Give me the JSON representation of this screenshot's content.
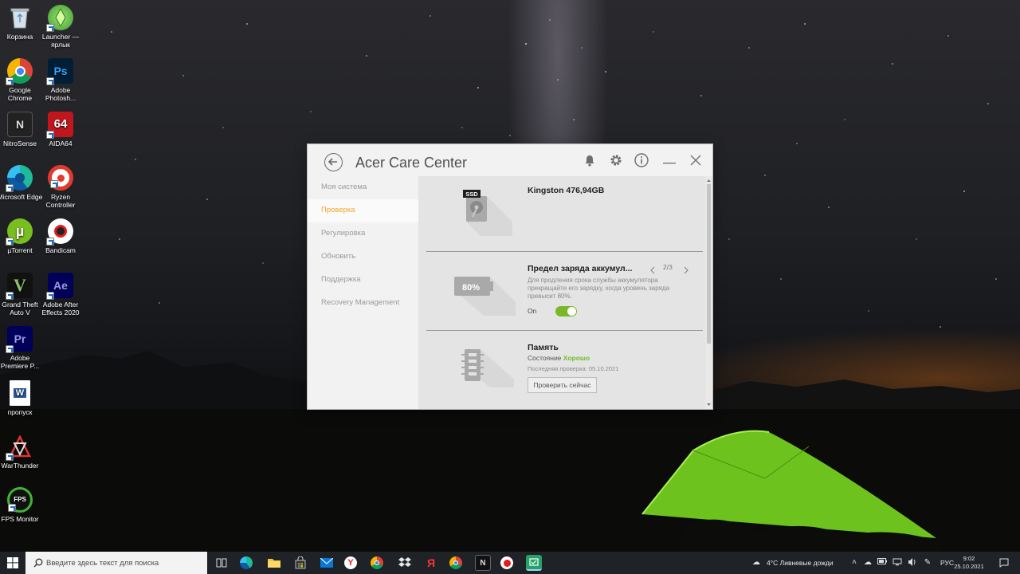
{
  "desktop": {
    "icons": [
      {
        "label": "Корзина",
        "icon": "recycle-bin-icon"
      },
      {
        "label": "Launcher — ярлык",
        "icon": "sims-launcher-icon"
      },
      {
        "label": "Google Chrome",
        "icon": "chrome-icon"
      },
      {
        "label": "Adobe Photosh...",
        "icon": "photoshop-icon",
        "glyph": "Ps"
      },
      {
        "label": "NitroSense",
        "icon": "nitrosense-icon",
        "glyph": "N"
      },
      {
        "label": "AIDA64",
        "icon": "aida64-icon",
        "glyph": "64"
      },
      {
        "label": "Microsoft Edge",
        "icon": "edge-icon"
      },
      {
        "label": "Ryzen Controller",
        "icon": "ryzen-controller-icon"
      },
      {
        "label": "µTorrent",
        "icon": "utorrent-icon",
        "glyph": "µ"
      },
      {
        "label": "Bandicam",
        "icon": "bandicam-icon"
      },
      {
        "label": "Grand Theft Auto V",
        "icon": "gta-v-icon",
        "glyph": "V"
      },
      {
        "label": "Adobe After Effects 2020",
        "icon": "after-effects-icon",
        "glyph": "Ae"
      },
      {
        "label": "Adobe Premiere P...",
        "icon": "premiere-icon",
        "glyph": "Pr"
      },
      {
        "label": "пропуск",
        "icon": "word-document-icon",
        "glyph": "W"
      },
      {
        "label": "WarThunder",
        "icon": "warthunder-icon"
      },
      {
        "label": "FPS Monitor",
        "icon": "fps-monitor-icon",
        "glyph": "FPS"
      }
    ]
  },
  "window": {
    "title": "Acer Care Center",
    "header_icons": [
      "back-arrow-icon",
      "bell-icon",
      "gear-icon",
      "info-icon",
      "minimize-icon",
      "close-icon"
    ],
    "sidebar": [
      {
        "label": "Моя система",
        "active": false
      },
      {
        "label": "Проверка",
        "active": true
      },
      {
        "label": "Регулировка",
        "active": false
      },
      {
        "label": "Обновить",
        "active": false
      },
      {
        "label": "Поддержка",
        "active": false
      },
      {
        "label": "Recovery Management",
        "active": false
      }
    ],
    "cards": {
      "ssd": {
        "badge": "SSD",
        "title": "Kingston 476,94GB"
      },
      "battery": {
        "badge": "80%",
        "title": "Предел заряда аккумул...",
        "pager": "2/3",
        "description": "Для продления срока службы аккумулятора прекращайте его зарядку, когда уровень заряда превысит 80%.",
        "toggle_label": "On",
        "toggle_on": true
      },
      "memory": {
        "title": "Память",
        "status_label": "Состояние",
        "status_value": "Хорошо",
        "last_check": "Последняя проверка: 05.10.2021",
        "button": "Проверить сейчас"
      }
    },
    "colors": {
      "accent": "#f5a623",
      "good": "#76b82a",
      "toggle": "#7ab829"
    }
  },
  "taskbar": {
    "search_placeholder": "Введите здесь текст для поиска",
    "apps": [
      "task-view-icon",
      "edge-icon",
      "file-explorer-icon",
      "store-icon",
      "mail-icon",
      "yandex-browser-icon",
      "chrome-icon",
      "dropbox-icon",
      "yandex-icon",
      "chrome-icon",
      "nitrosense-icon",
      "obs-record-icon",
      "acer-care-center-icon"
    ],
    "weather": "4°C  Ливневые дожди",
    "language": "РУС",
    "time": "9:02",
    "date": "25.10.2021"
  }
}
